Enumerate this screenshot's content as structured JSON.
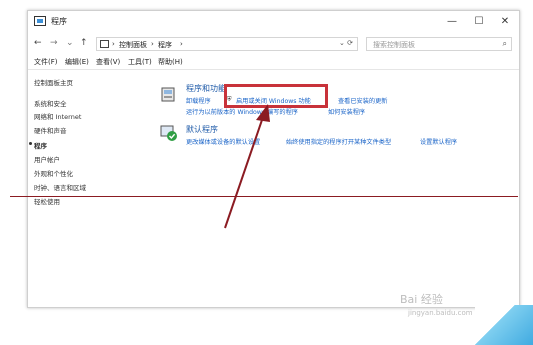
{
  "window": {
    "title": "程序",
    "controls": {
      "minimize": "—",
      "maximize": "☐",
      "close": "✕"
    }
  },
  "address_bar": {
    "back": "←",
    "forward": "→",
    "recent": "⌄",
    "up": "↑",
    "path": [
      "控制面板",
      "程序"
    ],
    "separator": "›",
    "refresh": "⟳",
    "dropdown": "⌄",
    "search_placeholder": "搜索控制面板"
  },
  "menu": [
    "文件(F)",
    "编辑(E)",
    "查看(V)",
    "工具(T)",
    "帮助(H)"
  ],
  "sidebar": {
    "items": [
      {
        "label": "控制面板主页",
        "active": false
      },
      {
        "label": "系统和安全",
        "active": false
      },
      {
        "label": "网络和 Internet",
        "active": false
      },
      {
        "label": "硬件和声音",
        "active": false
      },
      {
        "label": "程序",
        "active": true
      },
      {
        "label": "用户帐户",
        "active": false
      },
      {
        "label": "外观和个性化",
        "active": false
      },
      {
        "label": "时钟、语言和区域",
        "active": false
      },
      {
        "label": "轻松使用",
        "active": false
      }
    ]
  },
  "sections": [
    {
      "title": "程序和功能",
      "links": [
        "卸载程序",
        "启用或关闭 Windows 功能",
        "查看已安装的更新",
        "运行为以前版本的 Windows 编写的程序",
        "如何安装程序"
      ]
    },
    {
      "title": "默认程序",
      "links": [
        "更改媒体或设备的默认设置",
        "始终使用指定的程序打开某种文件类型",
        "设置默认程序"
      ]
    }
  ],
  "watermark": {
    "logo": "Bai 经验",
    "url": "jingyan.baidu.com"
  },
  "colors": {
    "highlight": "#c8323a",
    "link": "#1a64c8",
    "title": "#1e5aa8",
    "arrow": "#8b1b22"
  }
}
